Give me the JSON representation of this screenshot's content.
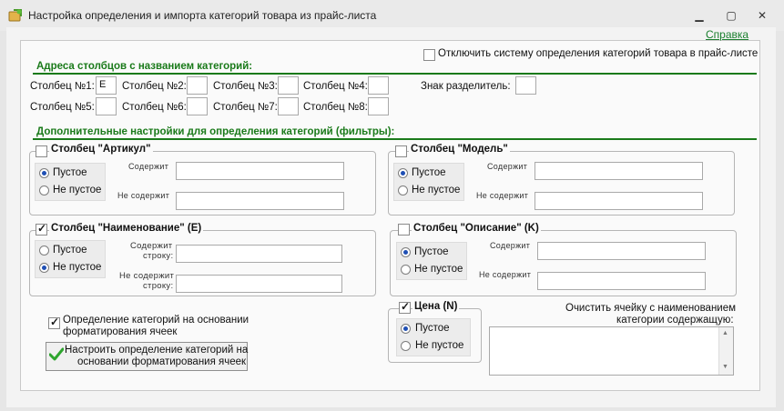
{
  "window": {
    "title": "Настройка определения и импорта категорий товара из прайс-листа",
    "minimize": "▁",
    "maximize": "▢",
    "close": "✕"
  },
  "help_link": "Справка",
  "disable_system": {
    "label": "Отключить систему определения категорий товара в прайс-листе",
    "checked": false
  },
  "addresses": {
    "title": "Адреса столбцов с названием категорий:",
    "columns": [
      {
        "label": "Столбец №1:",
        "value": "E"
      },
      {
        "label": "Столбец №2:",
        "value": ""
      },
      {
        "label": "Столбец №3:",
        "value": ""
      },
      {
        "label": "Столбец №4:",
        "value": ""
      },
      {
        "label": "Столбец №5:",
        "value": ""
      },
      {
        "label": "Столбец №6:",
        "value": ""
      },
      {
        "label": "Столбец №7:",
        "value": ""
      },
      {
        "label": "Столбец №8:",
        "value": ""
      }
    ],
    "separator": {
      "label": "Знак разделитель:",
      "value": ""
    }
  },
  "filters": {
    "title": "Дополнительные настройки для определения категорий (фильтры):",
    "article": {
      "label": "Столбец \"Артикул\"",
      "checked": false,
      "radio_empty": "Пустое",
      "radio_not_empty": "Не пустое",
      "selected": "empty",
      "contains_label": "Содержит",
      "not_contains_label": "Не содержит",
      "contains_value": "",
      "not_contains_value": ""
    },
    "model": {
      "label": "Столбец \"Модель\"",
      "checked": false,
      "radio_empty": "Пустое",
      "radio_not_empty": "Не пустое",
      "selected": "empty",
      "contains_label": "Содержит",
      "not_contains_label": "Не содержит",
      "contains_value": "",
      "not_contains_value": ""
    },
    "name": {
      "label": "Столбец \"Наименование\" (E)",
      "checked": true,
      "radio_empty": "Пустое",
      "radio_not_empty": "Не пустое",
      "selected": "not_empty",
      "contains_label_1": "Содержит",
      "contains_label_2": "строку:",
      "not_contains_label_1": "Не содержит",
      "not_contains_label_2": "строку:",
      "contains_value": "",
      "not_contains_value": ""
    },
    "description": {
      "label": "Столбец \"Описание\" (K)",
      "checked": false,
      "radio_empty": "Пустое",
      "radio_not_empty": "Не пустое",
      "selected": "empty",
      "contains_label": "Содержит",
      "not_contains_label": "Не содержит",
      "contains_value": "",
      "not_contains_value": ""
    },
    "price": {
      "label": "Цена (N)",
      "checked": true,
      "radio_empty": "Пустое",
      "radio_not_empty": "Не пустое",
      "selected": "empty"
    }
  },
  "formatting": {
    "checkbox_label_1": "Определение категорий на основании",
    "checkbox_label_2": "форматирования ячеек",
    "checked": true,
    "button_line_1": "Настроить определение категорий на",
    "button_line_2": "основании форматирования ячеек"
  },
  "clear_cell": {
    "label_1": "Очистить ячейку с наименованием",
    "label_2": "категории содержащую:",
    "value": ""
  },
  "colors": {
    "accent_green": "#1a7a1a",
    "link_green": "#1a7f2e",
    "radio_blue": "#1f4fb4"
  }
}
